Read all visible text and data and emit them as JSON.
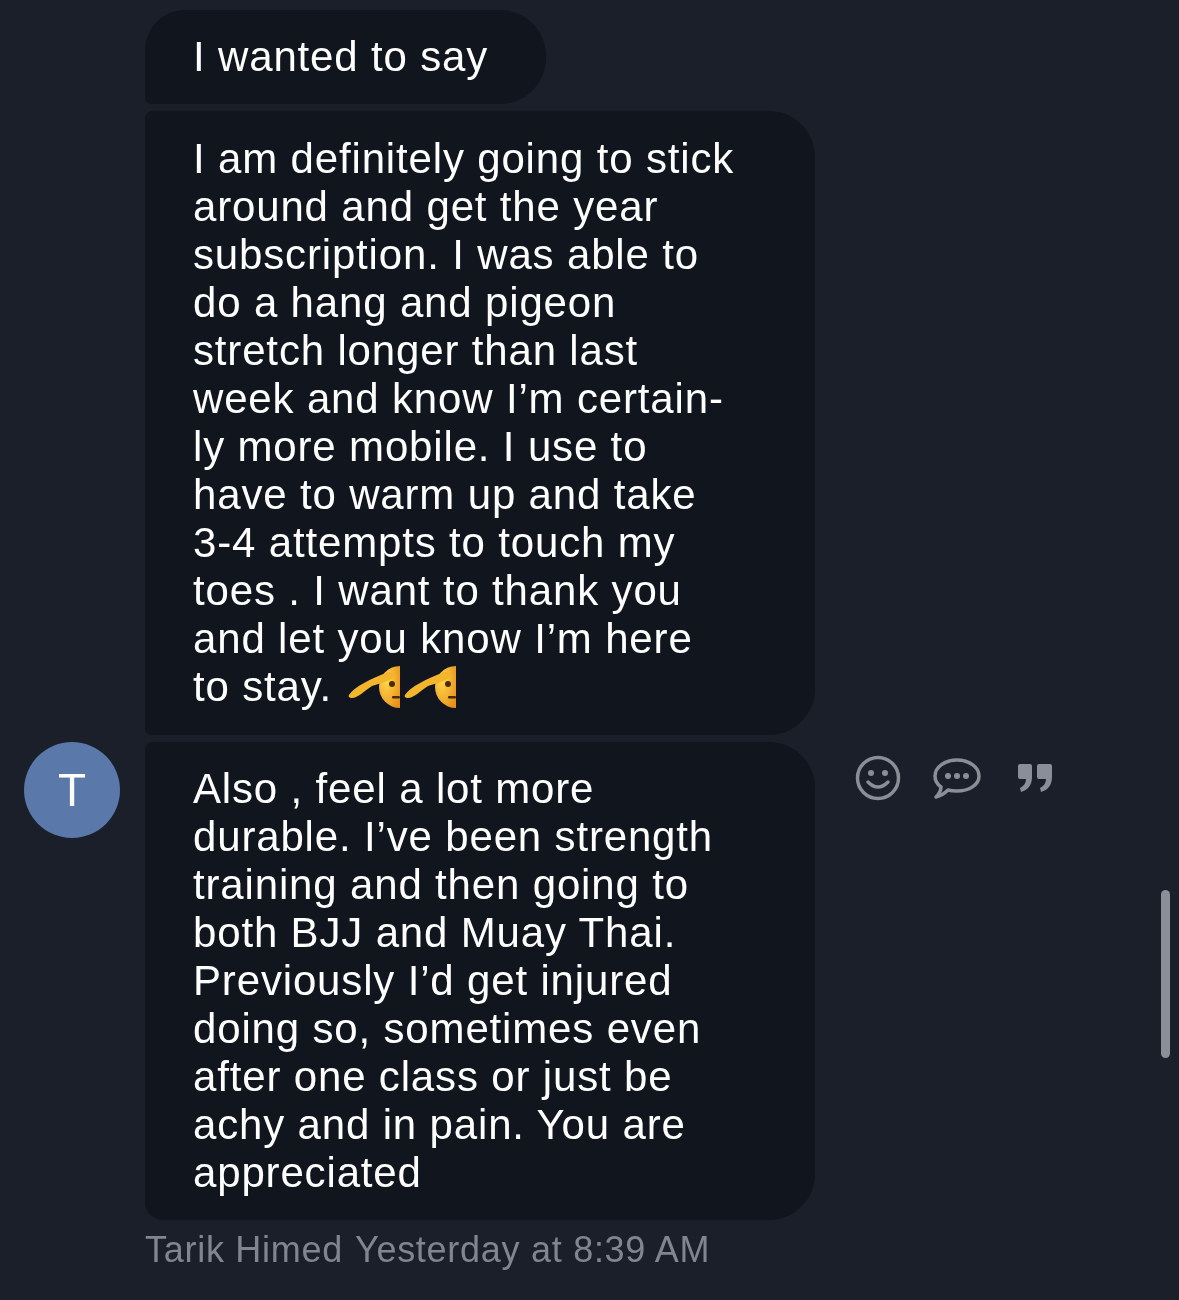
{
  "messages": [
    {
      "text": "I wanted to say"
    },
    {
      "text": "I am definitely going to stick\naround and get the year\nsubscription. I was able to\ndo a hang and pigeon\nstretch longer than last\nweek and know I’m certain-\nly more mobile. I use to\nhave to warm up and take\n3-4 attempts to touch my\ntoes . I want to thank you\nand let you know I’m here\nto stay.",
      "emojis": [
        {
          "kind": "salute"
        },
        {
          "kind": "salute"
        }
      ]
    },
    {
      "text": "Also , feel a lot more\ndurable. I’ve been strength\ntraining and then going to\nboth BJJ and Muay Thai.\nPreviously I’d get injured\ndoing so, sometimes even\nafter one class or just be\nachy and in pain. You are\nappreciated"
    }
  ],
  "avatar": {
    "initial": "T"
  },
  "footer": {
    "sender": "Tarik Himed",
    "time": "Yesterday at 8:39 AM"
  }
}
